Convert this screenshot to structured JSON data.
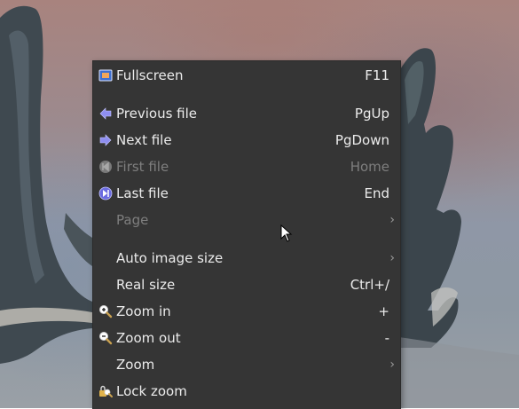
{
  "context_menu": {
    "items": [
      {
        "label": "Fullscreen",
        "shortcut": "F11",
        "icon": "fullscreen-icon",
        "enabled": true
      },
      {
        "label": "Previous file",
        "shortcut": "PgUp",
        "icon": "arrow-left-icon",
        "enabled": true
      },
      {
        "label": "Next file",
        "shortcut": "PgDown",
        "icon": "arrow-right-icon",
        "enabled": true
      },
      {
        "label": "First file",
        "shortcut": "Home",
        "icon": "first-file-icon",
        "enabled": false
      },
      {
        "label": "Last file",
        "shortcut": "End",
        "icon": "last-file-icon",
        "enabled": true
      },
      {
        "label": "Page",
        "shortcut": "",
        "icon": "",
        "submenu": true,
        "enabled": false
      },
      {
        "label": "Auto image size",
        "shortcut": "",
        "icon": "",
        "submenu": true,
        "enabled": true
      },
      {
        "label": "Real size",
        "shortcut": "Ctrl+/",
        "icon": "",
        "enabled": true
      },
      {
        "label": "Zoom in",
        "shortcut": "+",
        "icon": "zoom-in-icon",
        "enabled": true
      },
      {
        "label": "Zoom out",
        "shortcut": "-",
        "icon": "zoom-out-icon",
        "enabled": true
      },
      {
        "label": "Zoom",
        "shortcut": "",
        "icon": "",
        "submenu": true,
        "enabled": true
      },
      {
        "label": "Lock zoom",
        "shortcut": "",
        "icon": "lock-zoom-icon",
        "enabled": true
      }
    ],
    "submenu_arrow": "›"
  },
  "colors": {
    "menu_background": "#353535",
    "text": "#ececec",
    "disabled_text": "#7e7e7e",
    "icon_accent": "#7f7fe0"
  }
}
